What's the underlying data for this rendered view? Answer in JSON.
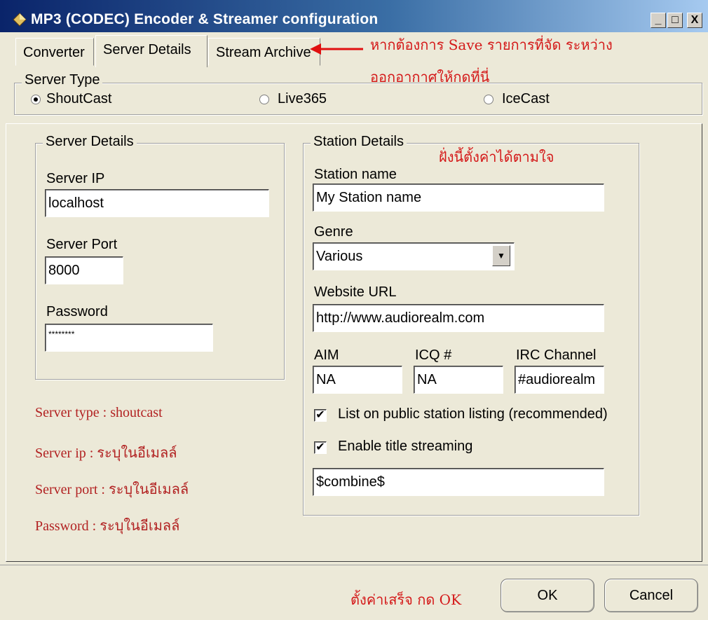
{
  "window": {
    "title": "MP3 (CODEC) Encoder & Streamer configuration",
    "minimize_glyph": "_",
    "maximize_glyph": "□",
    "close_glyph": "X"
  },
  "tabs": [
    {
      "label": "Converter"
    },
    {
      "label": "Server Details",
      "active": true
    },
    {
      "label": "Stream Archive"
    }
  ],
  "annotations": {
    "stream_archive_note_line1": "หากต้องการ Save รายการที่จัด ระหว่าง",
    "stream_archive_note_line2": "ออกอากาศให้กดที่นี่",
    "station_note": "ฝั่งนี้ตั้งค่าได้ตามใจ",
    "server_type": "Server type : shoutcast",
    "server_ip": "Server ip : ระบุในอีเมลล์",
    "server_port": "Server port : ระบุในอีเมลล์",
    "password": "Password : ระบุในอีเมลล์",
    "ok_note": "ตั้งค่าเสร็จ กด OK"
  },
  "server_type": {
    "legend": "Server Type",
    "options": [
      {
        "label": "ShoutCast",
        "checked": true
      },
      {
        "label": "Live365",
        "checked": false
      },
      {
        "label": "IceCast",
        "checked": false
      }
    ]
  },
  "server_details": {
    "legend": "Server Details",
    "ip_label": "Server IP",
    "ip_value": "localhost",
    "port_label": "Server Port",
    "port_value": "8000",
    "password_label": "Password",
    "password_value": "********"
  },
  "station_details": {
    "legend": "Station Details",
    "name_label": "Station name",
    "name_value": "My Station name",
    "genre_label": "Genre",
    "genre_value": "Various",
    "url_label": "Website URL",
    "url_value": "http://www.audiorealm.com",
    "aim_label": "AIM",
    "aim_value": "NA",
    "icq_label": "ICQ #",
    "icq_value": "NA",
    "irc_label": "IRC Channel",
    "irc_value": "#audiorealm",
    "public_listing_label": "List on public station listing (recommended)",
    "public_listing_checked": true,
    "title_streaming_label": "Enable title streaming",
    "title_streaming_checked": true,
    "title_value": "$combine$"
  },
  "buttons": {
    "ok": "OK",
    "cancel": "Cancel"
  },
  "colors": {
    "title_bar_start": "#0a246a",
    "title_bar_end": "#a6caf0",
    "annotation_red": "#d41919",
    "face": "#ece9d8"
  }
}
